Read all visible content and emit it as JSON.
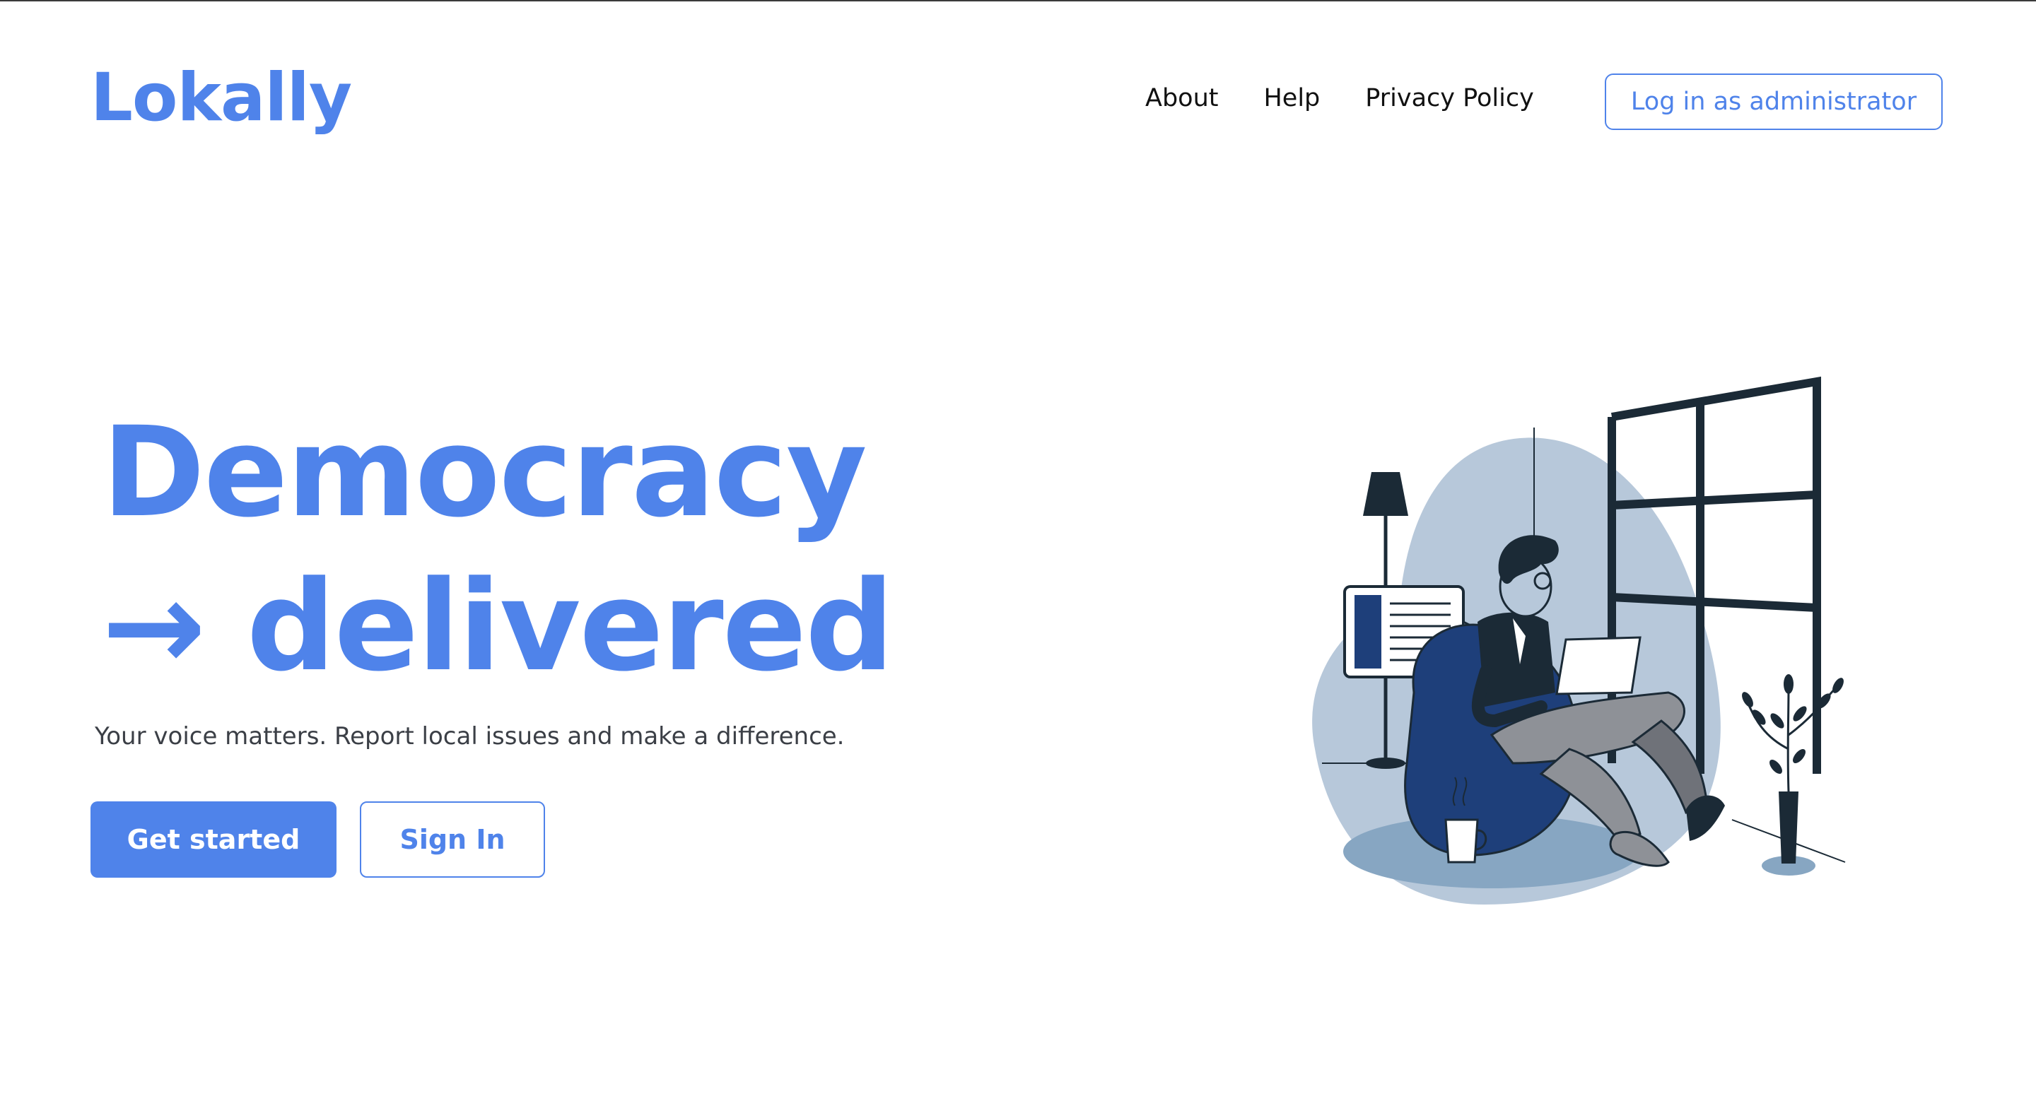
{
  "brand": {
    "name": "Lokally",
    "accent": "#4f83ea"
  },
  "nav": {
    "links": [
      "About",
      "Help",
      "Privacy Policy"
    ],
    "admin_button": "Log in as administrator"
  },
  "hero": {
    "title_line1": "Democracy",
    "title_line2": "→ delivered",
    "subtitle": "Your voice matters. Report local issues and make a difference.",
    "primary_button": "Get started",
    "secondary_button": "Sign In"
  },
  "illustration": {
    "subject": "person-with-laptop-illustration",
    "colors": {
      "blob": "#b7c8da",
      "floor": "#87a6c2",
      "chair": "#1e3f7a",
      "dark": "#1b2a36",
      "pants": "#8e9197"
    }
  }
}
